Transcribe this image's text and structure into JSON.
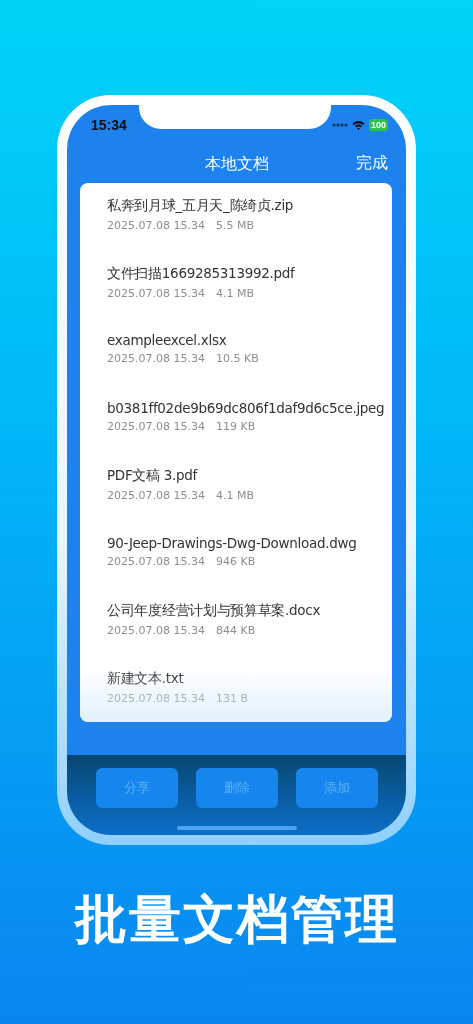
{
  "status_bar": {
    "time": "15:34",
    "battery": "100"
  },
  "nav_bar": {
    "title": "本地文档",
    "action": "完成"
  },
  "files": [
    {
      "name": "私奔到月球_五月天_陈绮贞.zip",
      "date": "2025.07.08 15.34",
      "size": "5.5 MB"
    },
    {
      "name": "文件扫描1669285313992.pdf",
      "date": "2025.07.08 15.34",
      "size": "4.1 MB"
    },
    {
      "name": "exampleexcel.xlsx",
      "date": "2025.07.08 15.34",
      "size": "10.5 KB"
    },
    {
      "name": "b0381ff02de9b69dc806f1daf9d6c5ce.jpeg",
      "date": "2025.07.08 15.34",
      "size": "119 KB"
    },
    {
      "name": "PDF文稿 3.pdf",
      "date": "2025.07.08 15.34",
      "size": "4.1 MB"
    },
    {
      "name": "90-Jeep-Drawings-Dwg-Download.dwg",
      "date": "2025.07.08 15.34",
      "size": "946 KB"
    },
    {
      "name": "公司年度经营计划与预算草案.docx",
      "date": "2025.07.08 15.34",
      "size": "844 KB"
    },
    {
      "name": "新建文本.txt",
      "date": "2025.07.08 15.34",
      "size": "131 B"
    }
  ],
  "toolbar": [
    {
      "label": "分享",
      "disabled": true
    },
    {
      "label": "删除",
      "disabled": true
    },
    {
      "label": "添加",
      "disabled": true
    }
  ],
  "headline": "批量文档管理"
}
